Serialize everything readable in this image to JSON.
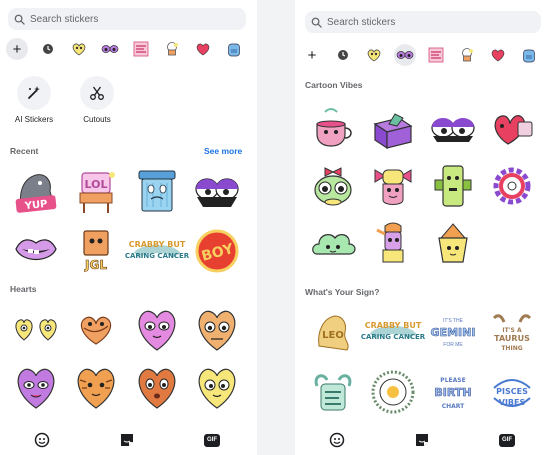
{
  "colors": {
    "search_bg": "#f0f2f5",
    "muted_text": "#65676b",
    "link_blue": "#1b74e4",
    "sticker_yellow": "#f7e77a",
    "sticker_purple": "#b87be0",
    "sticker_pink": "#e85a8a",
    "sticker_orange": "#f0a060"
  },
  "left_panel": {
    "search": {
      "placeholder": "Search stickers",
      "icon": "search-icon"
    },
    "tabs": [
      {
        "icon": "plus-icon",
        "active": true
      },
      {
        "icon": "recent-clock-icon"
      },
      {
        "icon": "yellow-heart-face-icon"
      },
      {
        "icon": "purple-eyes-icon"
      },
      {
        "icon": "retro-text-icon"
      },
      {
        "icon": "cupcake-icon"
      },
      {
        "icon": "red-heart-icon"
      },
      {
        "icon": "backpack-icon"
      }
    ],
    "tools": [
      {
        "label": "AI Stickers",
        "icon": "sparkle-wand-icon"
      },
      {
        "label": "Cutouts",
        "icon": "scissors-icon"
      }
    ],
    "recent": {
      "title": "Recent",
      "see_more": "See more",
      "stickers": [
        {
          "name": "pigeon-yup-sticker",
          "text": "YUP"
        },
        {
          "name": "lol-chair-sticker",
          "text": "LOL"
        },
        {
          "name": "blue-bin-face-sticker"
        },
        {
          "name": "purple-sunglasses-sticker"
        },
        {
          "name": "lips-sticker"
        },
        {
          "name": "jgl-chair-sticker",
          "text": "JGL"
        },
        {
          "name": "crabby-but-caring-cancer-sticker",
          "text": "CRABBY BUT CARING CANCER"
        },
        {
          "name": "boy-badge-sticker",
          "text": "BOY"
        }
      ]
    },
    "hearts": {
      "title": "Hearts",
      "stickers": [
        {
          "name": "heart-eyes-pair-sticker"
        },
        {
          "name": "heart-knot-sticker"
        },
        {
          "name": "pink-heart-face-sticker"
        },
        {
          "name": "orange-heart-face-sticker"
        },
        {
          "name": "purple-heart-face-sticker"
        },
        {
          "name": "tiger-heart-face-sticker"
        },
        {
          "name": "brown-heart-face-sticker"
        },
        {
          "name": "yellow-heart-face-sticker"
        }
      ]
    },
    "bottom_bar": [
      {
        "icon": "sticker-face-icon"
      },
      {
        "icon": "sticker-square-icon"
      },
      {
        "label": "GIF",
        "icon": "gif-icon"
      }
    ]
  },
  "right_panel": {
    "search": {
      "placeholder": "Search stickers",
      "icon": "search-icon"
    },
    "tabs": [
      {
        "icon": "plus-icon"
      },
      {
        "icon": "recent-clock-icon"
      },
      {
        "icon": "yellow-heart-face-icon"
      },
      {
        "icon": "purple-eyes-icon",
        "active": true
      },
      {
        "icon": "retro-text-icon"
      },
      {
        "icon": "cupcake-icon"
      },
      {
        "icon": "red-heart-icon"
      },
      {
        "icon": "backpack-icon"
      }
    ],
    "cartoon_vibes": {
      "title": "Cartoon Vibes",
      "stickers": [
        {
          "name": "teacup-sticker"
        },
        {
          "name": "purple-box-sticker"
        },
        {
          "name": "shades-eyes-sticker"
        },
        {
          "name": "red-heart-box-sticker"
        },
        {
          "name": "bow-frog-sticker"
        },
        {
          "name": "candy-creature-sticker"
        },
        {
          "name": "green-robot-sticker"
        },
        {
          "name": "flower-ring-sticker"
        },
        {
          "name": "green-cloud-sticker"
        },
        {
          "name": "lamp-creature-sticker"
        },
        {
          "name": "pyramid-ghost-sticker"
        }
      ]
    },
    "whats_your_sign": {
      "title": "What's Your Sign?",
      "stickers": [
        {
          "name": "leo-sticker",
          "text": "LEO"
        },
        {
          "name": "crabby-but-caring-cancer-sticker-2",
          "text": "CRABBY BUT CARING CANCER"
        },
        {
          "name": "gemini-sticker",
          "text": "GEMINI"
        },
        {
          "name": "taurus-sticker",
          "text": "TAURUS"
        },
        {
          "name": "aries-sticker"
        },
        {
          "name": "egg-sun-sticker"
        },
        {
          "name": "birthday-sticker",
          "text": "BIRTH"
        },
        {
          "name": "pisces-vibes-sticker",
          "text": "PISCES VIBES"
        }
      ]
    },
    "bottom_bar": [
      {
        "icon": "sticker-face-icon"
      },
      {
        "icon": "sticker-square-icon"
      },
      {
        "label": "GIF",
        "icon": "gif-icon"
      }
    ]
  }
}
